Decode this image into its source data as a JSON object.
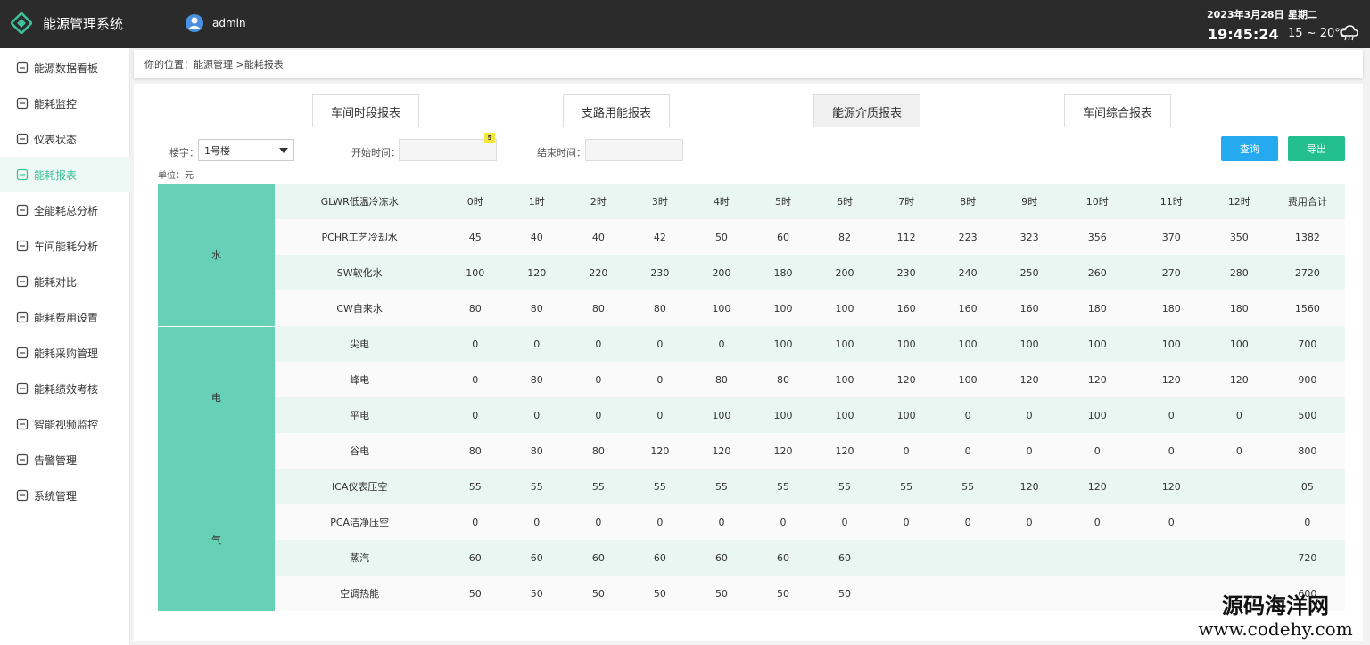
{
  "header": {
    "app_title": "能源管理系统",
    "user_name": "admin",
    "date": "2023年3月28日",
    "weekday": "星期二",
    "time": "19:45:24",
    "temperature": "15 ~ 20℃",
    "bg_color": "#2b2b2b",
    "logo_color": "#3cc19a"
  },
  "sidebar": {
    "items": [
      {
        "label": "能源数据看板",
        "icon": "chart-board-icon"
      },
      {
        "label": "能耗监控",
        "icon": "monitor-icon"
      },
      {
        "label": "仪表状态",
        "icon": "gauge-icon"
      },
      {
        "label": "能耗报表",
        "icon": "document-icon",
        "active": true
      },
      {
        "label": "全能耗总分析",
        "icon": "pie-chart-icon"
      },
      {
        "label": "车间能耗分析",
        "icon": "pie-chart-icon"
      },
      {
        "label": "能耗对比",
        "icon": "book-icon"
      },
      {
        "label": "能耗费用设置",
        "icon": "coin-icon"
      },
      {
        "label": "能耗采购管理",
        "icon": "cart-icon"
      },
      {
        "label": "能耗绩效考核",
        "icon": "trend-icon"
      },
      {
        "label": "智能视频监控",
        "icon": "camera-icon"
      },
      {
        "label": "告警管理",
        "icon": "alarm-icon"
      },
      {
        "label": "系统管理",
        "icon": "gear-icon"
      }
    ],
    "accent_color": "#3cc19a"
  },
  "breadcrumb": "你的位置：能源管理 >能耗报表",
  "tabs": [
    {
      "label": "车间时段报表"
    },
    {
      "label": "支路用能报表"
    },
    {
      "label": "能源介质报表",
      "active": true
    },
    {
      "label": "车间综合报表"
    }
  ],
  "filters": {
    "building_label": "楼宇：",
    "building_value": "1号楼",
    "start_label": "开始时间：",
    "start_value": "",
    "end_label": "结束时间：",
    "end_value": "",
    "badge": "5"
  },
  "buttons": {
    "query": "查询",
    "export": "导出",
    "query_color": "#25aaf0",
    "export_color": "#23c08e"
  },
  "unit_label": "单位：元",
  "table": {
    "category_color": "#66d1b6",
    "stripe_color": "#e9f6f1",
    "columns": [
      "GLWR低温冷冻水",
      "0时",
      "1时",
      "2时",
      "3时",
      "4时",
      "5时",
      "6时",
      "7时",
      "8时",
      "9时",
      "10时",
      "11时",
      "12时",
      "费用合计"
    ],
    "groups": [
      {
        "category": "水",
        "rows": [
          [
            "PCHR工艺冷却水",
            "45",
            "40",
            "40",
            "42",
            "50",
            "60",
            "82",
            "112",
            "223",
            "323",
            "356",
            "370",
            "350",
            "1382"
          ],
          [
            "SW软化水",
            "100",
            "120",
            "220",
            "230",
            "200",
            "180",
            "200",
            "230",
            "240",
            "250",
            "260",
            "270",
            "280",
            "2720"
          ],
          [
            "CW自来水",
            "80",
            "80",
            "80",
            "80",
            "100",
            "100",
            "100",
            "160",
            "160",
            "160",
            "180",
            "180",
            "180",
            "1560"
          ]
        ]
      },
      {
        "category": "电",
        "rows": [
          [
            "尖电",
            "0",
            "0",
            "0",
            "0",
            "0",
            "100",
            "100",
            "100",
            "100",
            "100",
            "100",
            "100",
            "100",
            "700"
          ],
          [
            "峰电",
            "0",
            "80",
            "0",
            "0",
            "80",
            "80",
            "100",
            "120",
            "100",
            "120",
            "120",
            "120",
            "120",
            "900"
          ],
          [
            "平电",
            "0",
            "0",
            "0",
            "0",
            "100",
            "100",
            "100",
            "100",
            "0",
            "0",
            "100",
            "0",
            "0",
            "500"
          ],
          [
            "谷电",
            "80",
            "80",
            "80",
            "120",
            "120",
            "120",
            "120",
            "0",
            "0",
            "0",
            "0",
            "0",
            "0",
            "800"
          ]
        ]
      },
      {
        "category": "气",
        "rows": [
          [
            "ICA仪表压空",
            "55",
            "55",
            "55",
            "55",
            "55",
            "55",
            "55",
            "55",
            "55",
            "120",
            "120",
            "120",
            "",
            "05"
          ],
          [
            "PCA洁净压空",
            "0",
            "0",
            "0",
            "0",
            "0",
            "0",
            "0",
            "0",
            "0",
            "0",
            "0",
            "0",
            "",
            "0"
          ],
          [
            "蒸汽",
            "60",
            "60",
            "60",
            "60",
            "60",
            "60",
            "60",
            "",
            "",
            "",
            "",
            "",
            "",
            "720"
          ],
          [
            "空调热能",
            "50",
            "50",
            "50",
            "50",
            "50",
            "50",
            "50",
            "",
            "",
            "",
            "",
            "",
            "",
            "600"
          ]
        ]
      }
    ]
  },
  "watermark": {
    "line1": "源码海洋网",
    "line2": "www.codehy.com"
  }
}
